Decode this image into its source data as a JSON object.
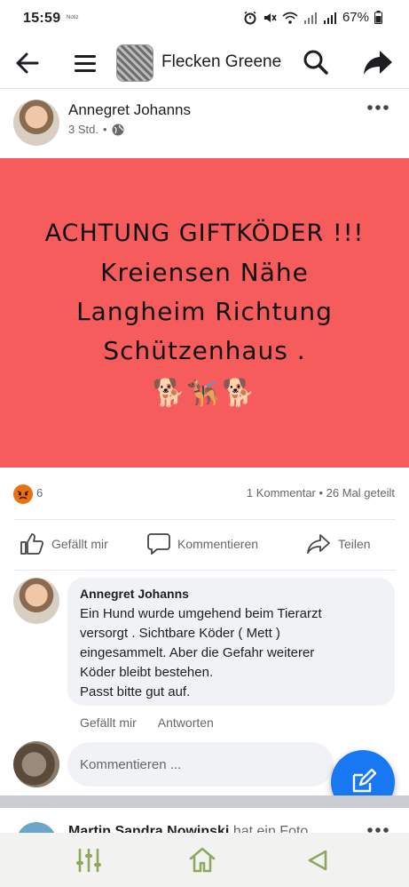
{
  "status_bar": {
    "time": "15:59",
    "carrier_note": "Notiz",
    "battery": "67%"
  },
  "app_bar": {
    "group_name": "Flecken Greene"
  },
  "post": {
    "author": "Annegret Johanns",
    "time": "3 Std.",
    "separator": "•",
    "banner_lines": [
      "ACHTUNG GIFTKÖDER !!!",
      "Kreiensen Nähe",
      "Langheim Richtung",
      "Schützenhaus ."
    ],
    "banner_emoji": "🐕🐕‍🦺🐕",
    "banner_color": "#f75c5c",
    "reactions_count": "6",
    "stats": "1 Kommentar • 26 Mal geteilt"
  },
  "actions": {
    "like": "Gefällt mir",
    "comment": "Kommentieren",
    "share": "Teilen"
  },
  "comment": {
    "author": "Annegret Johanns",
    "lines": [
      "Ein Hund  wurde umgehend  beim  Tierarzt",
      "versorgt . Sichtbare Köder  ( Mett )",
      "eingesammelt. Aber die Gefahr  weiterer",
      "Köder  bleibt  bestehen.",
      "Passt bitte  gut auf."
    ],
    "like": "Gefällt mir",
    "reply": "Antworten"
  },
  "composer": {
    "placeholder": "Kommentieren ..."
  },
  "next_post": {
    "name": "Martin Sandra Nowinski",
    "suffix": " hat ein Foto"
  },
  "colors": {
    "accent": "#1877f2",
    "angry_reaction": "#e9710f",
    "nav_icon": "#8fa860"
  }
}
